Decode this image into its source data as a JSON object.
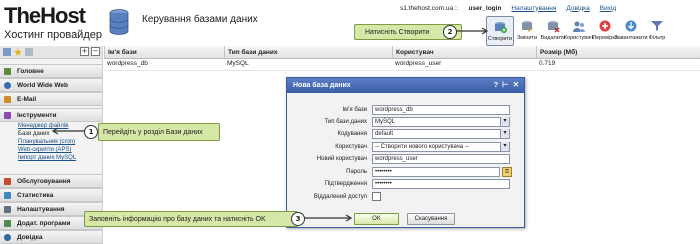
{
  "header": {
    "logo_main": "TheHost",
    "logo_sub": "Хостинг провайдер",
    "page_title": "Керування базами даних",
    "top_links": {
      "server": "s1.thehost.com.ua ::",
      "user": "user_login",
      "settings": "Налаштування",
      "help": "Довідка",
      "exit": "Вихід"
    },
    "toolbar": [
      {
        "label": "Створити",
        "icon": "create-icon"
      },
      {
        "label": "Змінити",
        "icon": "edit-icon"
      },
      {
        "label": "Видалити",
        "icon": "delete-icon"
      },
      {
        "label": "Користувачі",
        "icon": "users-icon"
      },
      {
        "label": "Перевірка",
        "icon": "check-icon"
      },
      {
        "label": "Завантажити",
        "icon": "download-icon"
      },
      {
        "label": "Фільтр",
        "icon": "filter-icon"
      }
    ]
  },
  "callouts": {
    "c1": {
      "num": "1",
      "text": "Перейдіть у розділ Бази даних"
    },
    "c2": {
      "num": "2",
      "text": "Натисніть Створити"
    },
    "c3": {
      "num": "3",
      "text": "Заповніть інформацію про базу даних та натисніть OK"
    }
  },
  "sidebar": {
    "sections": [
      {
        "label": "Головне",
        "color": "#5a8a3a"
      },
      {
        "label": "World Wide Web",
        "color": "#3a6ab0"
      },
      {
        "label": "E-Mail",
        "color": "#d08a2a"
      },
      {
        "label": "Інструменти",
        "color": "#8a4ab0"
      },
      {
        "label": "Обслуговування",
        "color": "#c05030"
      },
      {
        "label": "Статистика",
        "color": "#3a8ac0"
      },
      {
        "label": "Налаштування",
        "color": "#607080"
      },
      {
        "label": "Додат. програми",
        "color": "#508a50"
      },
      {
        "label": "Довідка",
        "color": "#2a6aa0"
      }
    ],
    "tool_links": [
      "Менеджер файлів",
      "Бази даних",
      "Планувальник (cron)",
      "Web-скрипти (APS)",
      "Імпорт даних MySQL"
    ]
  },
  "table": {
    "headers": [
      "Ім'я бази",
      "Тип бази даних",
      "Користувач",
      "Розмір (Мб)"
    ],
    "rows": [
      {
        "name": "wordpress_db",
        "type": "MySQL",
        "user": "wordpress_user",
        "size": "0.719"
      }
    ]
  },
  "dialog": {
    "title": "Нова база даних",
    "fields": [
      {
        "label": "Ім'я бази",
        "value": "wordpress_db",
        "kind": "text"
      },
      {
        "label": "Тип бази даних",
        "value": "MySQL",
        "kind": "select"
      },
      {
        "label": "Кодування",
        "value": "default",
        "kind": "select"
      },
      {
        "label": "Користувач",
        "value": "-- Створити нового користувача --",
        "kind": "select"
      },
      {
        "label": "Новий користувач",
        "value": "wordpress_user",
        "kind": "text"
      },
      {
        "label": "Пароль",
        "value": "••••••••",
        "kind": "password"
      },
      {
        "label": "Підтвердження",
        "value": "••••••••",
        "kind": "password"
      }
    ],
    "remote_access_label": "Віддалений доступ",
    "ok_label": "OK",
    "cancel_label": "Скасування"
  },
  "colors": {
    "accent": "#3a5ea8",
    "callout_bg": "#d6e8a8"
  }
}
